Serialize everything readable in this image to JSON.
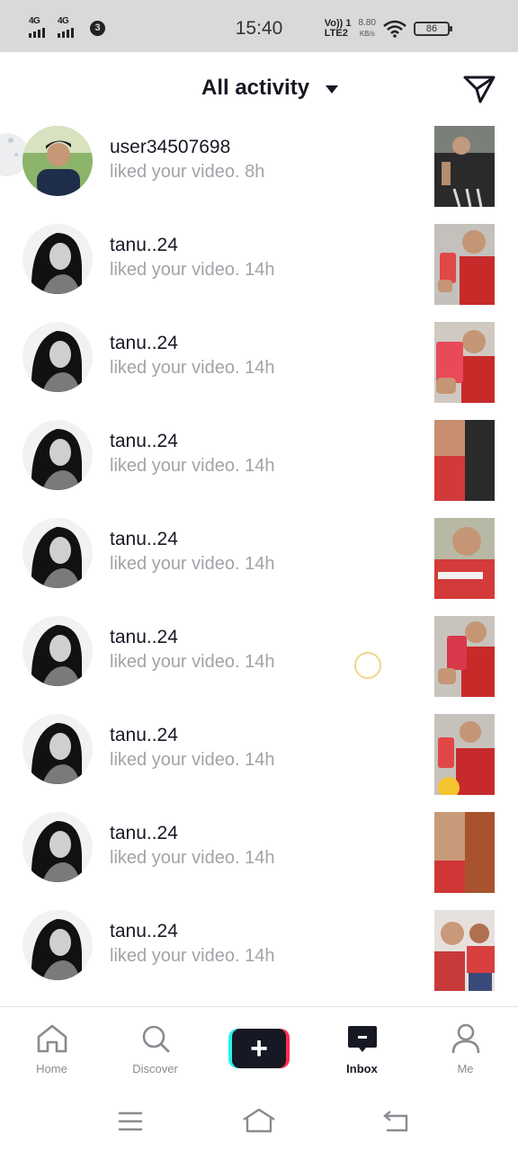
{
  "status_bar": {
    "net1": "4G",
    "net2": "4G",
    "sim_badge": "3",
    "time": "15:40",
    "volte_top": "Vo)) 1",
    "volte_bottom": "LTE2",
    "speed_value": "8.80",
    "speed_unit": "KB/s",
    "battery": "86"
  },
  "header": {
    "title": "All activity",
    "send_icon": "direct-message-icon"
  },
  "notifications": [
    {
      "username": "user34507698",
      "activity": "liked your video.",
      "time": "8h"
    },
    {
      "username": "tanu..24",
      "activity": "liked your video.",
      "time": "14h"
    },
    {
      "username": "tanu..24",
      "activity": "liked your video.",
      "time": "14h"
    },
    {
      "username": "tanu..24",
      "activity": "liked your video.",
      "time": "14h"
    },
    {
      "username": "tanu..24",
      "activity": "liked your video.",
      "time": "14h"
    },
    {
      "username": "tanu..24",
      "activity": "liked your video.",
      "time": "14h"
    },
    {
      "username": "tanu..24",
      "activity": "liked your video.",
      "time": "14h"
    },
    {
      "username": "tanu..24",
      "activity": "liked your video.",
      "time": "14h"
    },
    {
      "username": "tanu..24",
      "activity": "liked your video.",
      "time": "14h"
    }
  ],
  "bottom_nav": {
    "home": "Home",
    "discover": "Discover",
    "create": "+",
    "inbox": "Inbox",
    "me": "Me"
  },
  "colors": {
    "text_primary": "#161823",
    "text_secondary": "#a2a3a8",
    "accent_cyan": "#25f4ee",
    "accent_red": "#fe2c55"
  }
}
